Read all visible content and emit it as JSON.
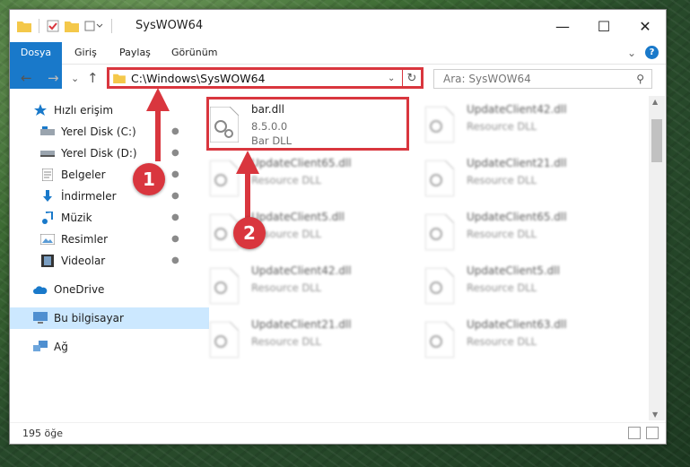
{
  "window": {
    "title": "SysWOW64"
  },
  "window_controls": {
    "minimize": "—",
    "maximize": "☐",
    "close": "✕"
  },
  "ribbon": {
    "tabs": [
      "Dosya",
      "Giriş",
      "Paylaş",
      "Görünüm"
    ],
    "expand_glyph": "⌄",
    "help_glyph": "?"
  },
  "nav": {
    "back": "←",
    "forward": "→",
    "recent": "⌄",
    "up": "↑"
  },
  "address": {
    "path": "C:\\Windows\\SysWOW64",
    "dropdown": "⌄",
    "refresh": "↻"
  },
  "search": {
    "placeholder": "Ara: SysWOW64",
    "icon_glyph": "⚲"
  },
  "sidebar": {
    "items": [
      {
        "label": "Hızlı erişim",
        "icon": "star-icon"
      },
      {
        "label": "Yerel Disk (C:)",
        "icon": "drive-icon",
        "pinned": true
      },
      {
        "label": "Yerel Disk (D:)",
        "icon": "drive-icon",
        "pinned": true
      },
      {
        "label": "Belgeler",
        "icon": "documents-icon",
        "pinned": true
      },
      {
        "label": "İndirmeler",
        "icon": "download-icon",
        "pinned": true
      },
      {
        "label": "Müzik",
        "icon": "music-icon",
        "pinned": true
      },
      {
        "label": "Resimler",
        "icon": "pictures-icon",
        "pinned": true
      },
      {
        "label": "Videolar",
        "icon": "video-icon",
        "pinned": true
      },
      {
        "label": "OneDrive",
        "icon": "cloud-icon"
      },
      {
        "label": "Bu bilgisayar",
        "icon": "computer-icon",
        "selected": true
      },
      {
        "label": "Ağ",
        "icon": "network-icon"
      }
    ],
    "pin_glyph": "📌"
  },
  "files": [
    {
      "name": "bar.dll",
      "version": "8.5.0.0",
      "desc": "Bar DLL",
      "highlighted": true
    },
    {
      "name": "UpdateClient42.dll",
      "desc": "Resource DLL"
    },
    {
      "name": "UpdateClient65.dll",
      "desc": "Resource DLL"
    },
    {
      "name": "UpdateClient21.dll",
      "desc": "Resource DLL"
    },
    {
      "name": "UpdateClient5.dll",
      "desc": "Resource DLL"
    },
    {
      "name": "UpdateClient65.dll",
      "desc": "Resource DLL"
    },
    {
      "name": "UpdateClient42.dll",
      "desc": "Resource DLL"
    },
    {
      "name": "UpdateClient5.dll",
      "desc": "Resource DLL"
    },
    {
      "name": "UpdateClient21.dll",
      "desc": "Resource DLL"
    },
    {
      "name": "UpdateClient63.dll",
      "desc": "Resource DLL"
    }
  ],
  "status": {
    "item_count": "195 öğe"
  },
  "callouts": [
    "1",
    "2"
  ],
  "colors": {
    "accent": "#1979ca",
    "highlight": "#d9363e",
    "selection": "#cce8ff"
  }
}
